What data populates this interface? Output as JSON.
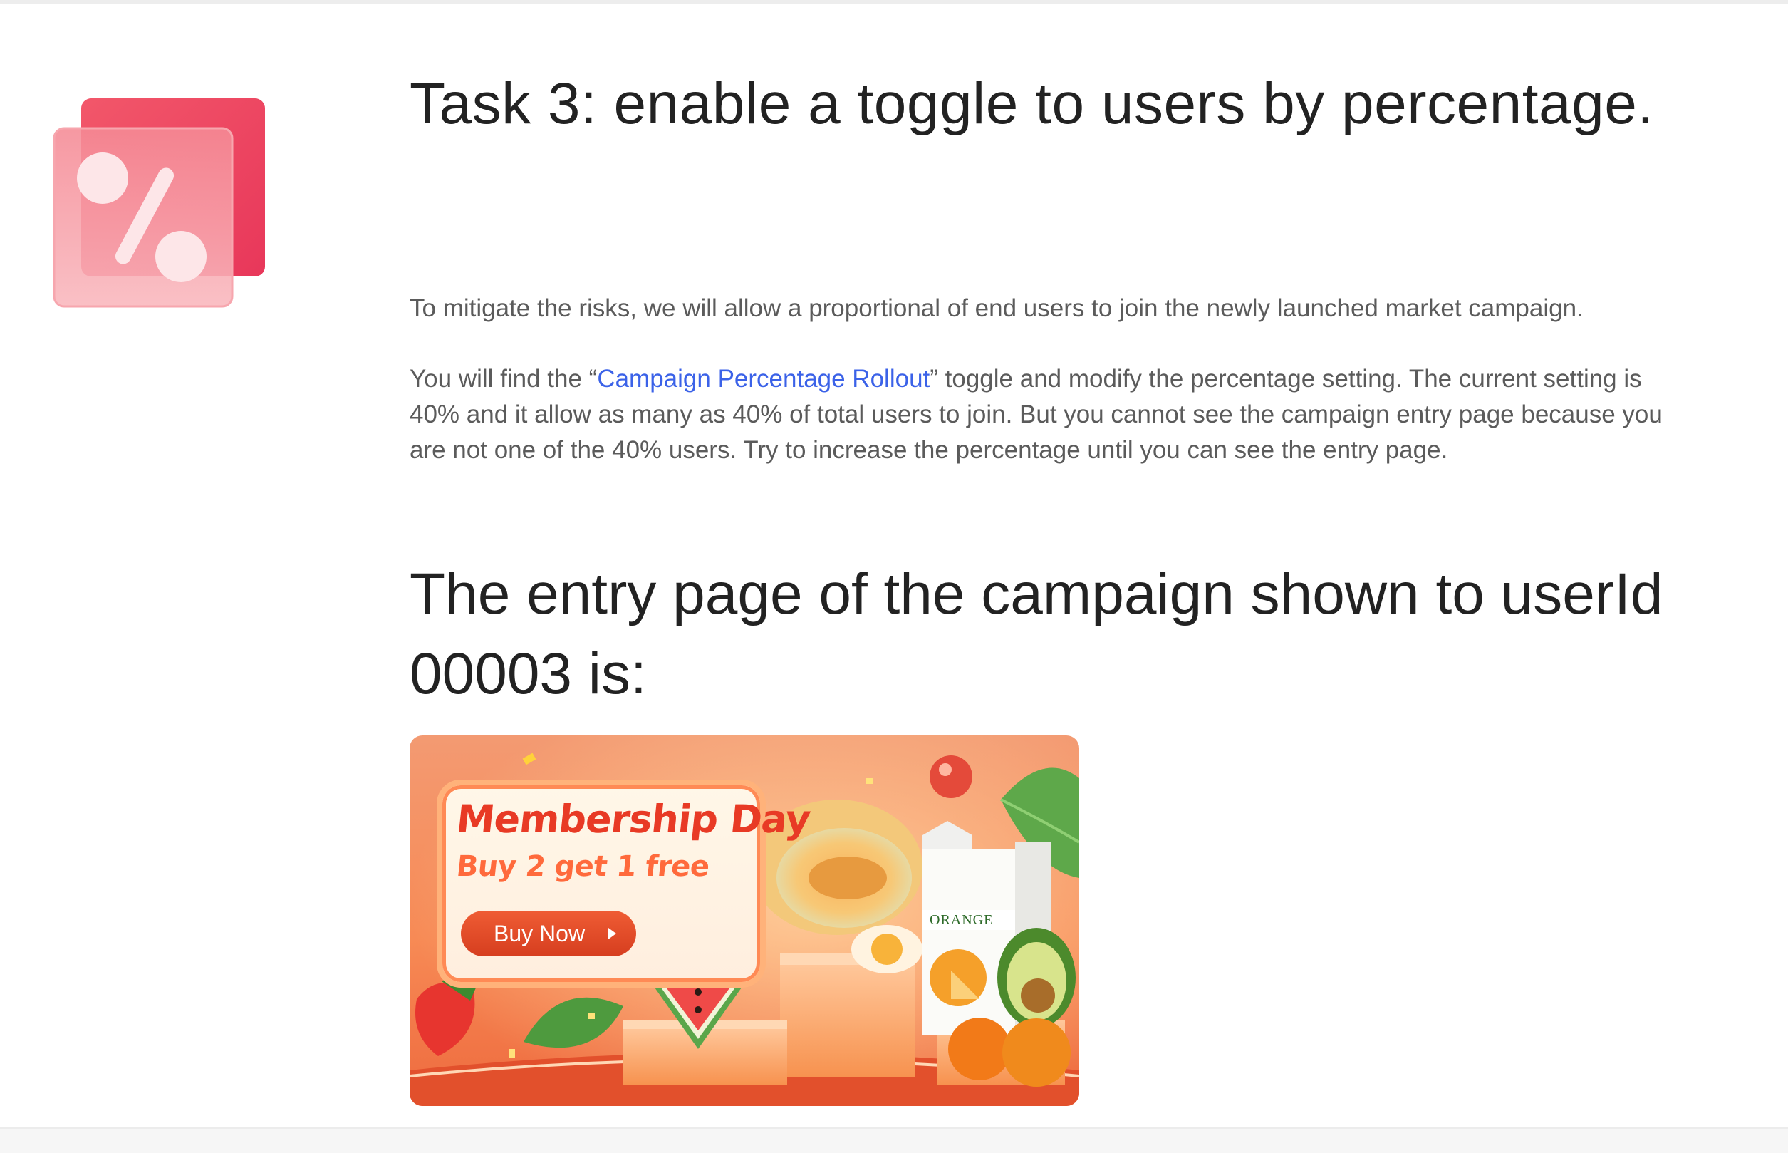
{
  "task": {
    "title": "Task 3: enable a toggle to users by percentage.",
    "icon": "percent-icon",
    "accent_color": "#ef4060"
  },
  "description": {
    "para1": "To mitigate the risks, we will allow a proportional of end users to join the newly launched market campaign.",
    "para2_before": "You will find the “",
    "para2_link": "Campaign Percentage Rollout",
    "para2_after": "” toggle and modify the percentage setting. The current setting is 40% and it allow as many as 40% of total users to join. But you cannot see the campaign entry page because you are not one of the 40% users. Try to increase the percentage until you can see the entry page.",
    "link_color": "#3b62e8"
  },
  "entry": {
    "heading": "The entry page of the campaign shown to userId 00003 is:"
  },
  "banner": {
    "headline": "Membership Day",
    "subheadline": "Buy 2 get 1 free",
    "button_label": "Buy Now",
    "carton_label": "ORANGE",
    "colors": {
      "background": "#f47b4a",
      "headline": "#e83a25",
      "button": "#d63e1f"
    }
  }
}
